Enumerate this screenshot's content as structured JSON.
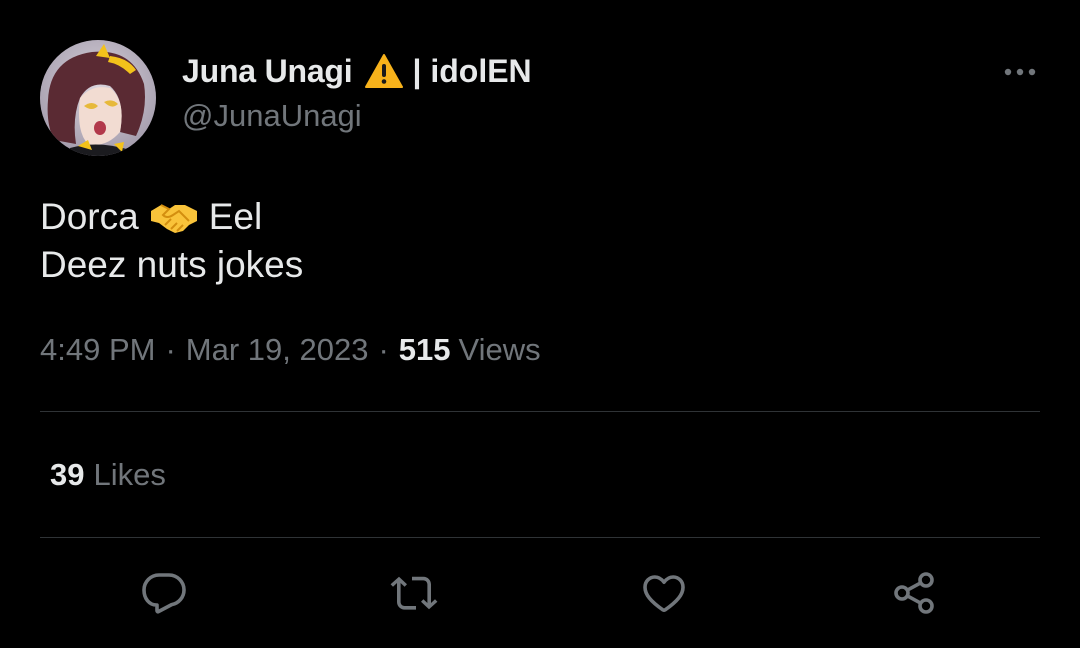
{
  "author": {
    "display_name": "Juna Unagi",
    "name_emoji": "warning-icon",
    "name_suffix": "| idolEN",
    "handle": "@JunaUnagi"
  },
  "tweet": {
    "line1_left": "Dorca",
    "line1_emoji": "handshake-icon",
    "line1_right": "Eel",
    "line2": "Deez nuts jokes"
  },
  "meta": {
    "time": "4:49 PM",
    "separator": "·",
    "date": "Mar 19, 2023",
    "views_count": "515",
    "views_label": "Views"
  },
  "stats": {
    "likes_count": "39",
    "likes_label": "Likes"
  },
  "actions": [
    "reply-icon",
    "retweet-icon",
    "like-icon",
    "share-icon"
  ],
  "colors": {
    "background": "#000000",
    "text_primary": "#e7e9ea",
    "text_secondary": "#71767b",
    "divider": "#2f3336",
    "warning": "#f7b21b",
    "handshake": "#f9c33a"
  }
}
